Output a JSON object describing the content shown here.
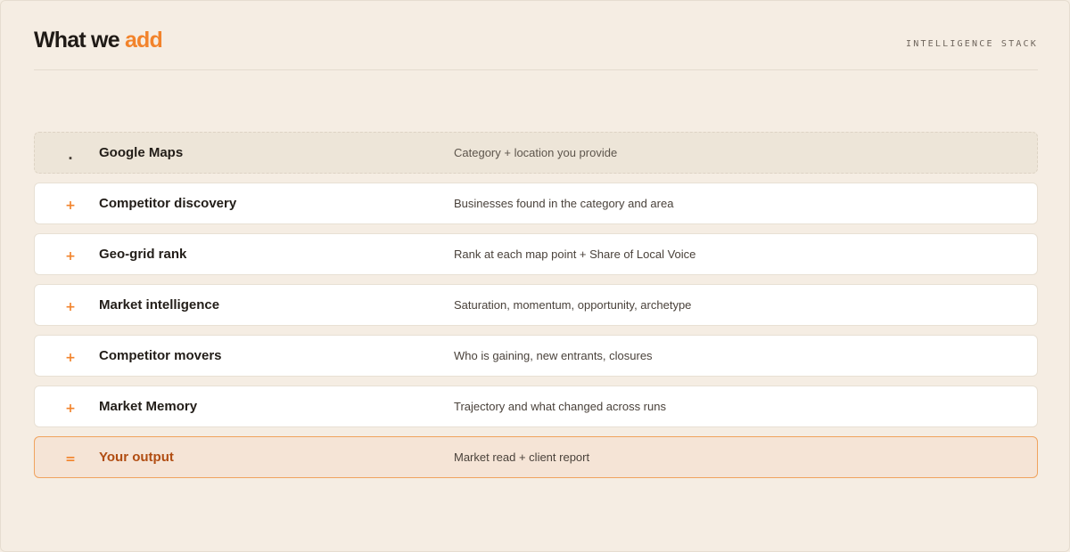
{
  "header": {
    "title_main": "What we",
    "title_accent": "add",
    "eyebrow": "INTELLIGENCE STACK"
  },
  "colors": {
    "accent": "#f2832b",
    "background": "#f5ede3",
    "output_text": "#b14d12"
  },
  "rows": [
    {
      "symbol": ".",
      "name": "Google Maps",
      "description": "Category + location you provide",
      "kind": "source"
    },
    {
      "symbol": "+",
      "name": "Competitor discovery",
      "description": "Businesses found in the category and area",
      "kind": "layer"
    },
    {
      "symbol": "+",
      "name": "Geo-grid rank",
      "description": "Rank at each map point + Share of Local Voice",
      "kind": "layer"
    },
    {
      "symbol": "+",
      "name": "Market intelligence",
      "description": "Saturation, momentum, opportunity, archetype",
      "kind": "layer"
    },
    {
      "symbol": "+",
      "name": "Competitor movers",
      "description": "Who is gaining, new entrants, closures",
      "kind": "layer"
    },
    {
      "symbol": "+",
      "name": "Market Memory",
      "description": "Trajectory and what changed across runs",
      "kind": "layer"
    },
    {
      "symbol": "=",
      "name": "Your output",
      "description": "Market read + client report",
      "kind": "output"
    }
  ]
}
